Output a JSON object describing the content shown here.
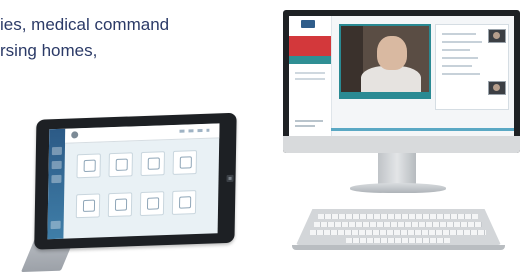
{
  "intro_text": {
    "line1": "ies, medical command",
    "line2": "rsing homes,"
  },
  "colors": {
    "text": "#2b3a67",
    "tablet_sidebar": "#2c5a86",
    "monitor_accent": "#2a8a93",
    "alert_band": "#d3383b"
  }
}
